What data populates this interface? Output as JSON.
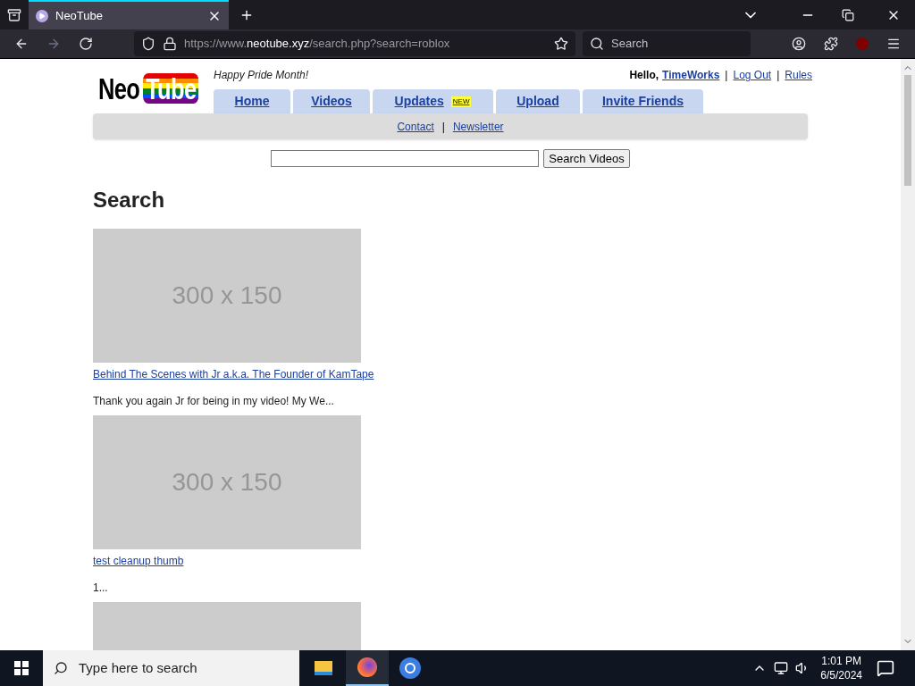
{
  "browser": {
    "tabs": [
      {
        "title": "NeoTube",
        "selected": true
      }
    ],
    "url": {
      "prefix": "https://www.",
      "domain": "neotube.xyz",
      "path": "/search.php?search=roblox"
    },
    "search_placeholder": "Search"
  },
  "site": {
    "logo": {
      "part_1": "Neo",
      "part_2": "Tube"
    },
    "tagline": "Happy Pride Month!",
    "greeting": "Hello,",
    "username": "TimeWorks",
    "user_links": [
      "Log Out",
      "Rules"
    ],
    "separator": "|",
    "nav": [
      {
        "label": "Home"
      },
      {
        "label": "Videos"
      },
      {
        "label": "Updates",
        "badge": "NEW"
      },
      {
        "label": "Upload"
      },
      {
        "label": "Invite Friends"
      }
    ],
    "subnav": [
      "Contact",
      "Newsletter"
    ],
    "search_button": "Search Videos",
    "heading": "Search",
    "results": [
      {
        "kind": "thumbnail",
        "image_label": "300 x 150",
        "title": "Behind The Scenes with Jr a.k.a. The Founder of KamTape",
        "snippet": "Thank you again Jr for being in my video! My We..."
      },
      {
        "kind": "thumbnail",
        "image_label": "300 x 150",
        "title": "test cleanup thumb",
        "snippet": "1..."
      },
      {
        "kind": "thumbnail"
      }
    ]
  },
  "taskbar": {
    "search_placeholder": "Type here to search",
    "time": "1:01 PM",
    "date": "6/5/2024"
  }
}
